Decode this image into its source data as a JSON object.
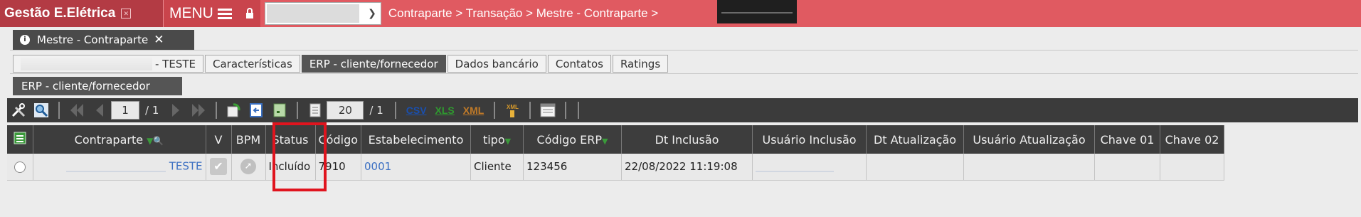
{
  "app": {
    "title": "Gestão E.Elétrica",
    "menu_label": "MENU"
  },
  "breadcrumb": "Contraparte > Transação > Mestre - Contraparte >",
  "window_tab": {
    "label": "Mestre - Contraparte",
    "close": "✕"
  },
  "subtabs": [
    {
      "label": "- TESTE"
    },
    {
      "label": "Características"
    },
    {
      "label": "ERP - cliente/fornecedor"
    },
    {
      "label": "Dados bancário"
    },
    {
      "label": "Contatos"
    },
    {
      "label": "Ratings"
    }
  ],
  "section_tab": "ERP - cliente/fornecedor",
  "toolbar": {
    "page": "1",
    "page_total": "/ 1",
    "rows": "20",
    "rows_total": "/ 1",
    "csv": "CSV",
    "xls": "XLS",
    "xml": "XML"
  },
  "table": {
    "headers": [
      "Contraparte",
      "V",
      "BPM",
      "Status",
      "Código",
      "Estabelecimento",
      "tipo",
      "Código ERP",
      "Dt Inclusão",
      "Usuário Inclusão",
      "Dt Atualização",
      "Usuário Atualização",
      "Chave 01",
      "Chave 02"
    ],
    "row": {
      "contraparte": "TESTE",
      "status": "Incluído",
      "codigo": "7910",
      "estabelecimento": "0001",
      "tipo": "Cliente",
      "codigo_erp": "123456",
      "dt_inclusao": "22/08/2022 11:19:08"
    }
  },
  "colors": {
    "topbar": "#e05a61",
    "brand": "#b33b44",
    "highlight": "#e0141e",
    "link": "#3b6fc2"
  }
}
